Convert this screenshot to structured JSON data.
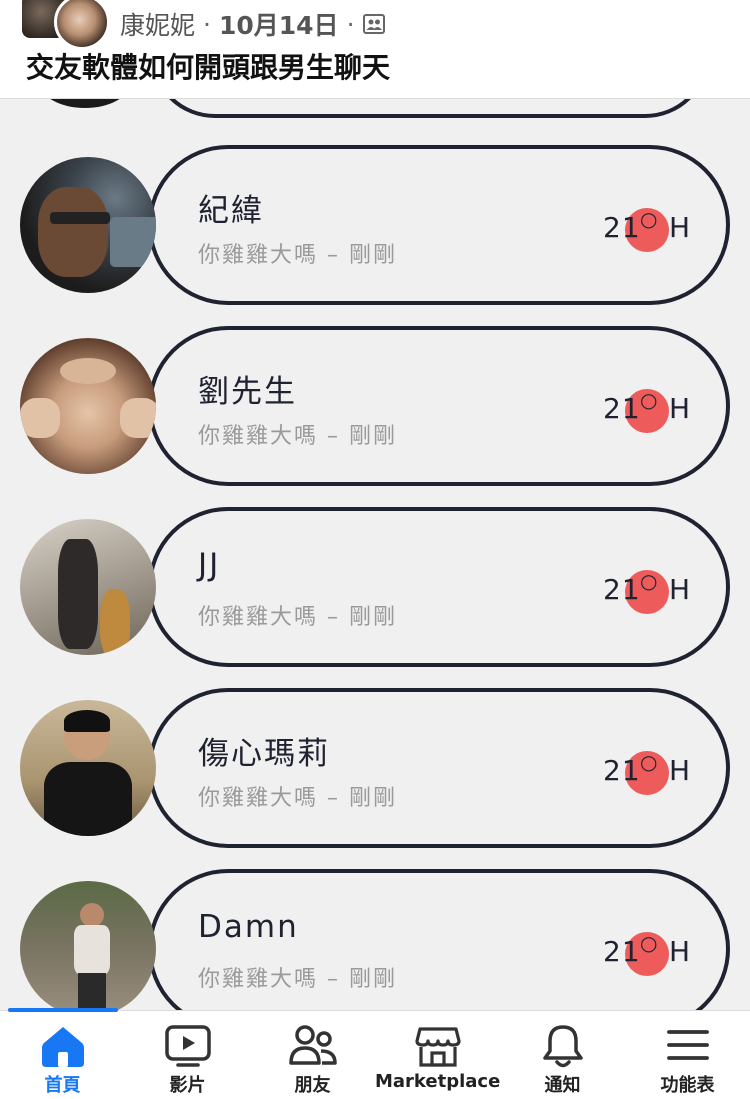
{
  "post": {
    "author": "康妮妮",
    "date": "10月14日",
    "title": "交友軟體如何開頭跟男生聊天"
  },
  "chats": [
    {
      "name": "紀緯",
      "preview": "你雞雞大嗎 – 剛剛",
      "temp": "21",
      "unit": "H"
    },
    {
      "name": "劉先生",
      "preview": "你雞雞大嗎 – 剛剛",
      "temp": "21",
      "unit": "H"
    },
    {
      "name": "JJ",
      "preview": "你雞雞大嗎 – 剛剛",
      "temp": "21",
      "unit": "H"
    },
    {
      "name": "傷心瑪莉",
      "preview": "你雞雞大嗎 – 剛剛",
      "temp": "21",
      "unit": "H"
    },
    {
      "name": "Damn",
      "preview": "你雞雞大嗎 – 剛剛",
      "temp": "21",
      "unit": "H"
    }
  ],
  "nav": {
    "home": "首頁",
    "video": "影片",
    "friends": "朋友",
    "marketplace": "Marketplace",
    "notifications": "通知",
    "menu": "功能表"
  },
  "colors": {
    "accent": "#1877f2",
    "dot": "#ee5b5b",
    "outline": "#1f2230"
  }
}
